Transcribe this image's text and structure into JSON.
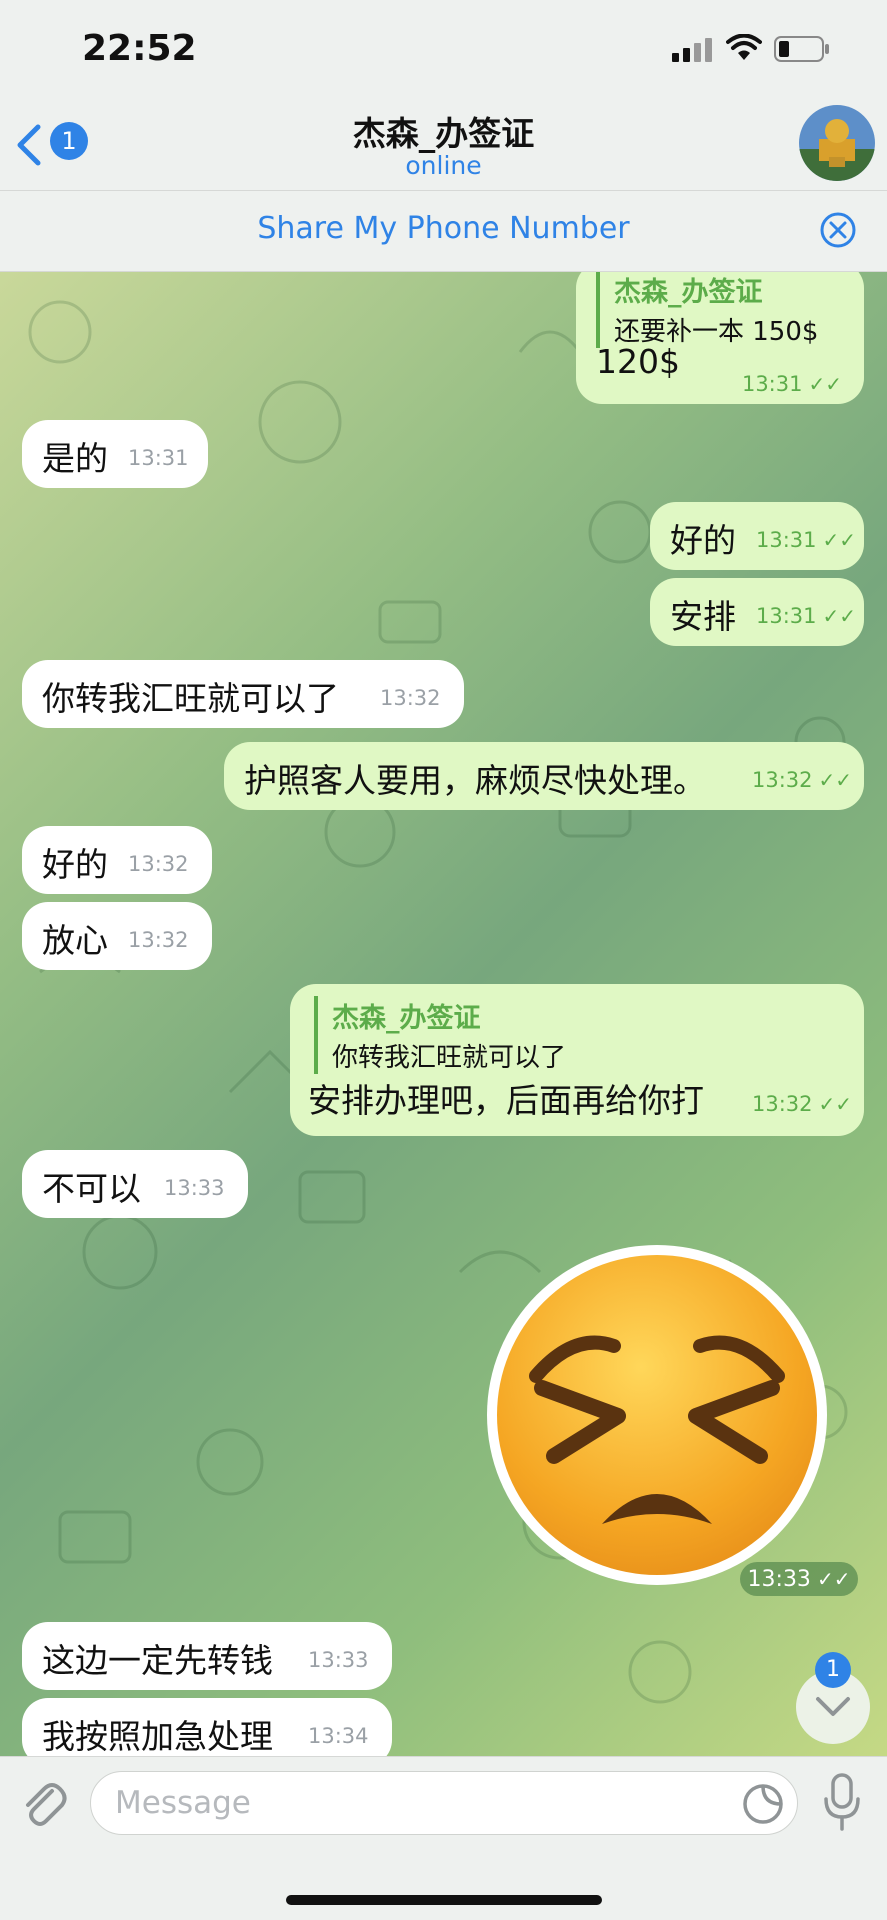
{
  "status_bar": {
    "time": "22:52"
  },
  "header": {
    "back_badge": "1",
    "title": "杰森_办签证",
    "subtitle": "online"
  },
  "share_bar": {
    "label": "Share My Phone Number"
  },
  "messages": [
    {
      "dir": "out",
      "reply_name": "杰森_办签证",
      "reply_text": "还要补一本 150$",
      "text": "120$",
      "time": "13:31"
    },
    {
      "dir": "in",
      "text": "是的",
      "time": "13:31"
    },
    {
      "dir": "out",
      "text": "好的",
      "time": "13:31"
    },
    {
      "dir": "out",
      "text": "安排",
      "time": "13:31"
    },
    {
      "dir": "in",
      "text": "你转我汇旺就可以了",
      "time": "13:32"
    },
    {
      "dir": "out",
      "text": "护照客人要用，麻烦尽快处理。",
      "time": "13:32"
    },
    {
      "dir": "in",
      "text": "好的",
      "time": "13:32"
    },
    {
      "dir": "in",
      "text": "放心",
      "time": "13:32"
    },
    {
      "dir": "out",
      "reply_name": "杰森_办签证",
      "reply_text": "你转我汇旺就可以了",
      "text": "安排办理吧，后面再给你打",
      "time": "13:32"
    },
    {
      "dir": "in",
      "text": "不可以",
      "time": "13:33"
    },
    {
      "dir": "out",
      "sticker": "persevering-face",
      "time": "13:33"
    },
    {
      "dir": "in",
      "text": "这边一定先转钱",
      "time": "13:33"
    },
    {
      "dir": "in",
      "text": "我按照加急处理",
      "time": "13:34"
    }
  ],
  "ticks": "✓✓",
  "scroll_down_badge": "1",
  "composer": {
    "placeholder": "Message"
  },
  "colors": {
    "accent": "#2f83e6",
    "outgoing_bubble": "#e0f8c4",
    "incoming_bubble": "#ffffff",
    "outgoing_meta": "#5cac4a"
  }
}
